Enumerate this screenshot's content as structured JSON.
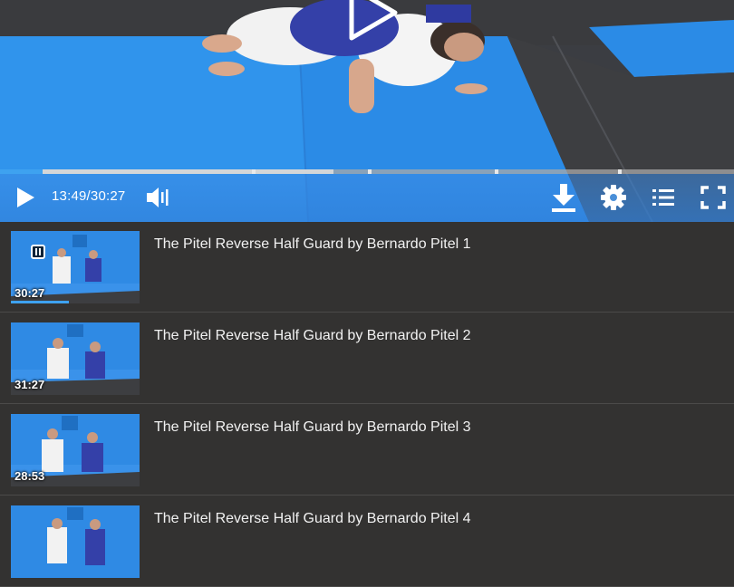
{
  "player": {
    "current_time": "13:49",
    "duration": "30:27",
    "time_separator": "/",
    "progress_fraction": 0.454,
    "buffered_fraction": 0.058,
    "accent_color": "#3ea2f0",
    "controls": {
      "play_icon": "play-icon",
      "volume_icon": "volume-icon",
      "download_icon": "download-icon",
      "settings_icon": "gear-icon",
      "playlist_icon": "list-icon",
      "fullscreen_icon": "fullscreen-icon"
    }
  },
  "playlist": {
    "items": [
      {
        "title": "The Pitel Reverse Half Guard by Bernardo Pitel 1",
        "duration": "30:27",
        "playing": true
      },
      {
        "title": "The Pitel Reverse Half Guard by Bernardo Pitel 2",
        "duration": "31:27",
        "playing": false
      },
      {
        "title": "The Pitel Reverse Half Guard by Bernardo Pitel 3",
        "duration": "28:53",
        "playing": false
      },
      {
        "title": "The Pitel Reverse Half Guard by Bernardo Pitel 4",
        "duration": "",
        "playing": false
      }
    ]
  }
}
